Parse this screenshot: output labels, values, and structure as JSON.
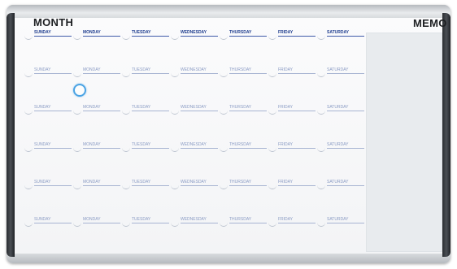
{
  "board": {
    "left_title": "MONTH",
    "right_title": "MEMO"
  },
  "calendar": {
    "weeks": [
      [
        "SUNDAY",
        "MONDAY",
        "TUESDAY",
        "WEDNESDAY",
        "THURSDAY",
        "FRIDAY",
        "SATURDAY"
      ],
      [
        "SUNDAY",
        "MONDAY",
        "TUESDAY",
        "WEDNESDAY",
        "THURSDAY",
        "FRIDAY",
        "SATURDAY"
      ],
      [
        "SUNDAY",
        "MONDAY",
        "TUESDAY",
        "WEDNESDAY",
        "THURSDAY",
        "FRIDAY",
        "SATURDAY"
      ],
      [
        "SUNDAY",
        "MONDAY",
        "TUESDAY",
        "WEDNESDAY",
        "THURSDAY",
        "FRIDAY",
        "SATURDAY"
      ],
      [
        "SUNDAY",
        "MONDAY",
        "TUESDAY",
        "WEDNESDAY",
        "THURSDAY",
        "FRIDAY",
        "SATURDAY"
      ],
      [
        "SUNDAY",
        "MONDAY",
        "TUESDAY",
        "WEDNESDAY",
        "THURSDAY",
        "FRIDAY",
        "SATURDAY"
      ]
    ]
  },
  "colors": {
    "frame": "#1f2226",
    "header_text": "#1f3d8f",
    "day_text": "#8a9bc4",
    "magnet": "#4aa3e4"
  }
}
